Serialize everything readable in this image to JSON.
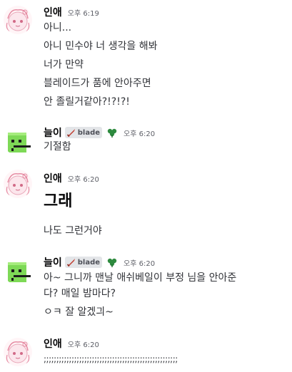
{
  "messages": [
    {
      "author": "인애",
      "time": "오후 6:19",
      "lines": [
        "아니...",
        "아니 민수야 너 생각을 해봐",
        "너가 만약",
        "블레이드가 품에 안아주면",
        "안 졸릴거같아?!?!?!"
      ]
    },
    {
      "author": "늘이",
      "role": "blade",
      "time": "오후 6:20",
      "lines": [
        "기절함"
      ]
    },
    {
      "author": "인애",
      "time": "오후 6:20",
      "lines": [
        "그래",
        "나도 그런거야"
      ]
    },
    {
      "author": "늘이",
      "role": "blade",
      "time": "오후 6:20",
      "lines": [
        "아~ 그니까 맨날 애쉬베일이 부정 님을 안아준",
        "다? 매일 밤마다?",
        "ㅇㅋ 잘 알겠긔~"
      ]
    },
    {
      "author": "인애",
      "time": "오후 6:20",
      "lines": [
        ";;;;;;;;;;;;;;;;;;;;;;;;;;;;;;;;;;;;;;;;;;;;;;;;;;;;;"
      ]
    }
  ],
  "icons": {
    "role_icon": "sword-icon",
    "badge_icon": "clover-icon",
    "avatar_ine": "pink-anime-avatar",
    "avatar_neuri": "green-pixel-avatar"
  },
  "colors": {
    "background": "#ffffff",
    "username": "#060607",
    "text": "#313338",
    "timestamp": "#5c5e66",
    "role_tag_bg": "#e3e5e8",
    "clover": "#2d8a3e"
  }
}
